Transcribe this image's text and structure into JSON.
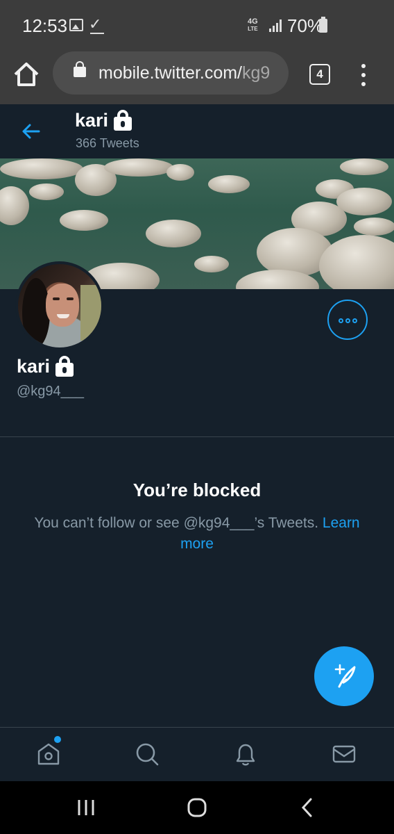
{
  "status_bar": {
    "time": "12:53",
    "network": "4G LTE",
    "battery": "70%",
    "icons": [
      "image-icon",
      "checkmark-icon",
      "signal-icon",
      "battery-icon"
    ]
  },
  "browser": {
    "url_host": "mobile.twitter.com/",
    "url_path": "kg9",
    "tab_count": "4"
  },
  "header": {
    "name": "kari",
    "tweet_count": "366 Tweets"
  },
  "profile": {
    "name": "kari",
    "handle": "@kg94___"
  },
  "blocked": {
    "title": "You’re blocked",
    "message": "You can’t follow or see @kg94___’s Tweets.",
    "link": "Learn more"
  },
  "bottom_nav": {
    "items": [
      "home-icon",
      "search-icon",
      "bell-icon",
      "mail-icon"
    ],
    "has_notification_dot": true
  },
  "colors": {
    "background": "#15202b",
    "accent": "#1da1f2",
    "secondary_text": "#8899a6",
    "divider": "#38444d",
    "chrome": "#3c3c3c"
  }
}
